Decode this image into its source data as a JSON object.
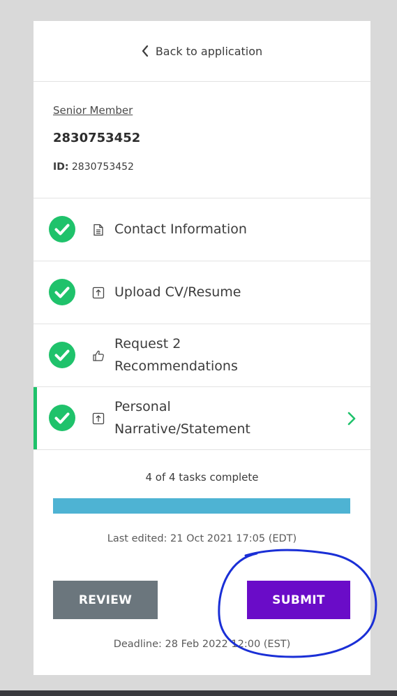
{
  "nav": {
    "back_label": "Back to application"
  },
  "member": {
    "role": "Senior Member",
    "number": "2830753452",
    "id_label": "ID:",
    "id_value": "2830753452"
  },
  "tasks": [
    {
      "label": "Contact Information",
      "icon": "document-icon",
      "status": "complete"
    },
    {
      "label": "Upload CV/Resume",
      "icon": "upload-icon",
      "status": "complete"
    },
    {
      "label_line1": "Request 2",
      "label_line2": "Recommendations",
      "icon": "thumbs-up-icon",
      "status": "complete"
    },
    {
      "label_line1": "Personal",
      "label_line2": "Narrative/Statement",
      "icon": "upload-icon",
      "status": "complete",
      "active": true
    }
  ],
  "progress": {
    "text": "4 of 4 tasks complete",
    "completed": 4,
    "total": 4,
    "fraction": 1.0
  },
  "last_edited": "Last edited: 21 Oct 2021 17:05 (EDT)",
  "actions": {
    "review_label": "REVIEW",
    "submit_label": "SUBMIT"
  },
  "deadline": "Deadline: 28 Feb 2022 12:00 (EST)",
  "colors": {
    "check_green": "#1fc26b",
    "active_accent": "#1fc26b",
    "progress_fill": "#4eb3d3",
    "review_bg": "#6b767d",
    "submit_bg": "#6a0cc8",
    "annotation_ink": "#1a2fd6"
  }
}
